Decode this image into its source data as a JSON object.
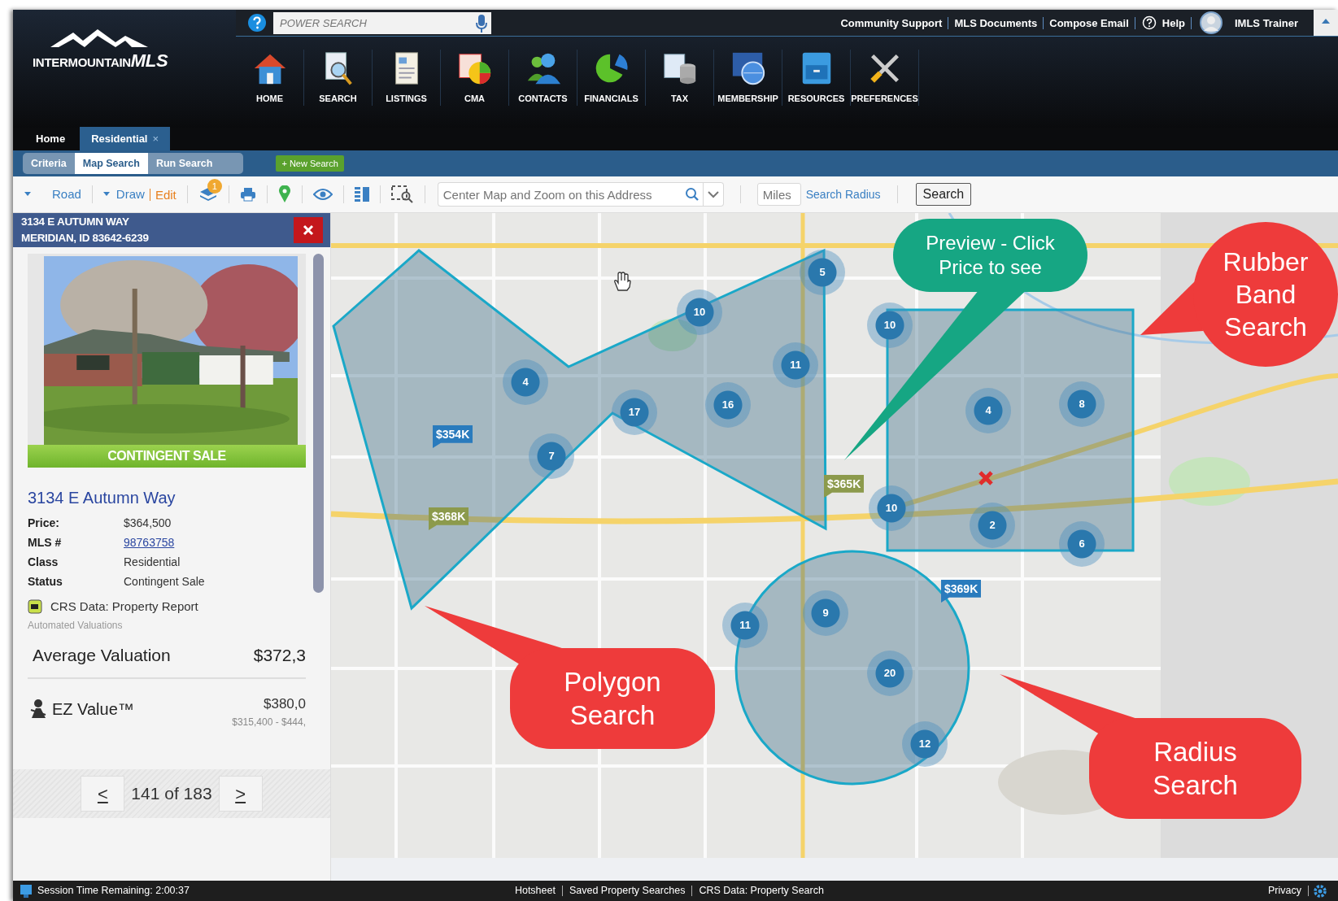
{
  "header": {
    "logo": {
      "text": "INTERMOUNTAIN",
      "emphasis": "MLS"
    },
    "power_search": {
      "placeholder": "POWER SEARCH"
    },
    "top_links": [
      {
        "label": "Community Support",
        "kind": "link"
      },
      {
        "label": "MLS Documents",
        "kind": "link"
      },
      {
        "label": "Compose Email",
        "kind": "link"
      },
      {
        "label": "Help",
        "kind": "help"
      },
      {
        "label": "IMLS Trainer",
        "kind": "user"
      }
    ],
    "nav": [
      {
        "label": "HOME",
        "kind": "home"
      },
      {
        "label": "SEARCH",
        "kind": "search"
      },
      {
        "label": "LISTINGS",
        "kind": "listings"
      },
      {
        "label": "CMA",
        "kind": "cma"
      },
      {
        "label": "CONTACTS",
        "kind": "contacts"
      },
      {
        "label": "FINANCIALS",
        "kind": "financials"
      },
      {
        "label": "TAX",
        "kind": "tax"
      },
      {
        "label": "MEMBERSHIP",
        "kind": "membership"
      },
      {
        "label": "RESOURCES",
        "kind": "resources"
      },
      {
        "label": "PREFERENCES",
        "kind": "preferences"
      }
    ]
  },
  "tabs": [
    {
      "label": "Home",
      "selected": false
    },
    {
      "label": "Residential",
      "selected": true,
      "close_symbol": "×"
    }
  ],
  "subtabs": [
    {
      "label": "Criteria",
      "selected": false
    },
    {
      "label": "Map Search",
      "selected": true
    },
    {
      "label": "Run Search",
      "selected": false
    }
  ],
  "new_search": {
    "icon": "+",
    "label": "New Search"
  },
  "toolbar": {
    "map_type": "Road",
    "draw": "Draw",
    "edit": "Edit",
    "layers_badge": "1",
    "address": {
      "placeholder": "Center Map and Zoom on this Address"
    },
    "miles": {
      "placeholder": "Miles"
    },
    "radius_link": "Search Radius",
    "search_button": "Search"
  },
  "listing": {
    "address_lines": [
      "3134 E AUTUMN WAY",
      "MERIDIAN, ID 83642-6239"
    ],
    "banner": "CONTINGENT SALE",
    "title": "3134 E Autumn Way",
    "details": [
      {
        "label": "Price:",
        "value": "$364,500",
        "kind": "text"
      },
      {
        "label": "MLS #",
        "value": "98763758",
        "kind": "link"
      },
      {
        "label": "Class",
        "value": "Residential",
        "kind": "text"
      },
      {
        "label": "Status",
        "value": "Contingent Sale",
        "kind": "text"
      }
    ],
    "crs_link": "CRS Data: Property Report",
    "valuations_heading": "Automated Valuations",
    "average": {
      "label": "Average Valuation",
      "value": "$372,3"
    },
    "ez": {
      "label": "EZ Value™",
      "value": "$380,0",
      "range": "$315,400 - $444,"
    },
    "pager": {
      "prev": "<",
      "position": "141 of 183",
      "next": ">"
    }
  },
  "map": {
    "clusters": [
      {
        "count": "5"
      },
      {
        "count": "10"
      },
      {
        "count": "4"
      },
      {
        "count": "11"
      },
      {
        "count": "17"
      },
      {
        "count": "16"
      },
      {
        "count": "7"
      },
      {
        "count": "10"
      },
      {
        "count": "4"
      },
      {
        "count": "8"
      },
      {
        "count": "10"
      },
      {
        "count": "2"
      },
      {
        "count": "6"
      },
      {
        "count": "11"
      },
      {
        "count": "9"
      },
      {
        "count": "20"
      },
      {
        "count": "12"
      }
    ],
    "price_markers": [
      {
        "label": "$354K",
        "color": "#2a7bbd"
      },
      {
        "label": "$368K",
        "color": "#8c9a4c"
      },
      {
        "label": "$365K",
        "color": "#8c9a4c"
      },
      {
        "label": "$369K",
        "color": "#2a7bbd"
      }
    ],
    "callouts": [
      {
        "text": "Preview - Click Price to see",
        "color": "#16a683",
        "kind": "rounded"
      },
      {
        "text": "Rubber Band Search",
        "color": "#ee3b3b",
        "kind": "circle"
      },
      {
        "text": "Polygon Search",
        "color": "#ee3b3b",
        "kind": "rounded"
      },
      {
        "text": "Radius Search",
        "color": "#ee3b3b",
        "kind": "rounded"
      }
    ]
  },
  "status_bar": {
    "session": "Session Time Remaining: 2:00:37",
    "links": [
      "Hotsheet",
      "Saved Property Searches",
      "CRS Data: Property Search"
    ],
    "privacy": "Privacy"
  }
}
